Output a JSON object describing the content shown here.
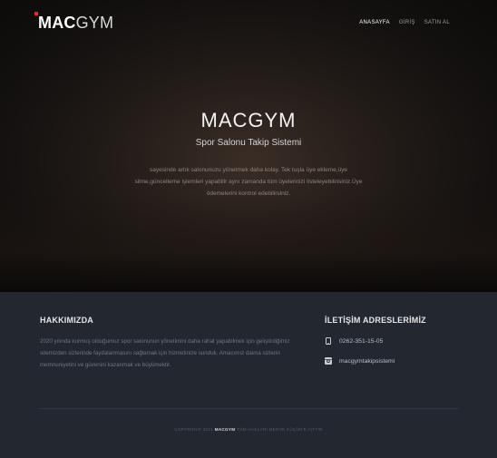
{
  "brand": {
    "logo_bold": "MAC",
    "logo_light": "GYM",
    "accent_color": "#e8262a"
  },
  "nav": {
    "items": [
      {
        "label": "ANASAYFA",
        "active": true
      },
      {
        "label": "GİRİŞ",
        "active": false
      },
      {
        "label": "SATIN AL",
        "active": false
      }
    ]
  },
  "hero": {
    "title": "MACGYM",
    "subtitle": "Spor Salonu Takip Sistemi",
    "description": "sayesinde artık salonunuzu yönetmek daha kolay. Tek tuşla üye ekleme,üye silme,güncelleme işlemleri yapabilir aynı zamanda tüm üyelerinizi listeleyebilirisiniz.Üye ödemelerini kontrol edebilirsiniz."
  },
  "footer": {
    "about": {
      "title": "HAKKIMIZDA",
      "text": "2020 yılında kurmuş olduğumuz spor salonunun yönetimini daha rahat yapabilmek için geliştirdiğimiz sitemizden sizlerinde faydalanmasını sağlamak için hizmetinize sunduk. Amacımız daima sizlerin memnuniyetini ve güvenini kazanmak ve büyümektir."
    },
    "contact": {
      "title": "İLETİŞİM ADRESLERİMİZ",
      "phone": "0262-351-15-05",
      "phone_icon": "phone-icon",
      "instagram": "macgymtakipsistemi",
      "instagram_icon": "instagram-icon"
    },
    "copyright_prefix": "COPYRIGHT 2021",
    "copyright_brand": "MACGYM",
    "copyright_suffix": "TÜM HAKLARI MERVE KÜÇÜK'E AİTTİR"
  }
}
